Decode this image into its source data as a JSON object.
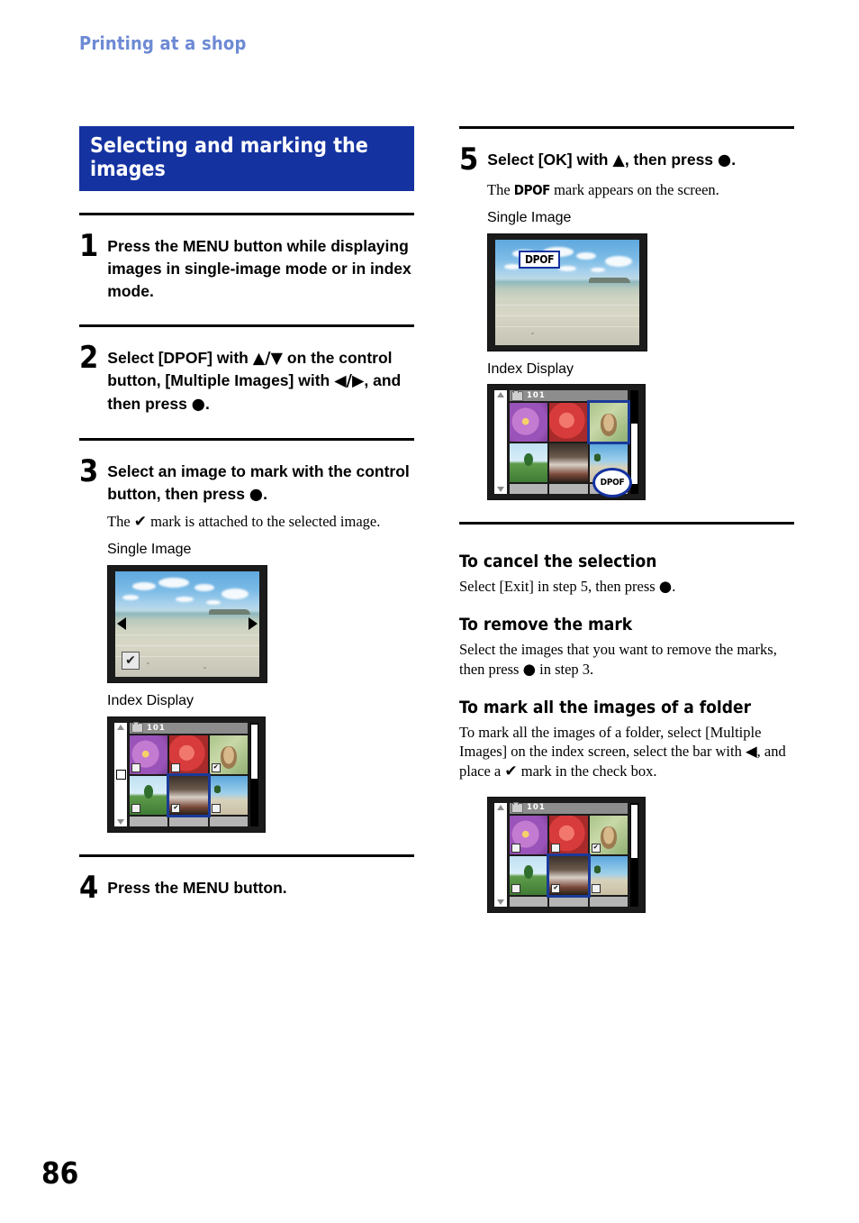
{
  "running_head": "Printing at a shop",
  "page_number": "86",
  "section": {
    "title_line1": "Selecting and marking the",
    "title_line2": "images"
  },
  "glyphs": {
    "up": "▲",
    "down": "▼",
    "left": "◀",
    "right": "▶",
    "enter": "●",
    "check": "✔",
    "checkbox_empty": "",
    "dpof": "DPOF"
  },
  "steps": [
    {
      "num": "1",
      "text": "Press the MENU button while displaying images in single-image mode or in index mode."
    },
    {
      "num": "2",
      "text_a": "Select [DPOF] with ",
      "arrow_ud": "▲/▼",
      "text_b": " on the control button, [Multiple Images] with ",
      "arrow_lr": "◀/▶",
      "text_c": ", and then press ",
      "enter": "●",
      "text_d": "."
    },
    {
      "num": "3",
      "text_a": "Select an image to mark with the control button, then press ",
      "enter": "●",
      "text_b": "."
    },
    {
      "num": "4",
      "text": "Press the MENU button."
    },
    {
      "num": "5",
      "text_a": "Select [OK] with ",
      "arrow_up": "▲",
      "text_b": ", then press ",
      "enter": "●",
      "text_c": "."
    }
  ],
  "step3_note": {
    "before": "The ",
    "mark": "✔",
    "after": " mark is attached to the selected image."
  },
  "step5_note": {
    "before": "The ",
    "mark": "DPOF",
    "after": " mark appears on the screen."
  },
  "captions": {
    "single_image": "Single Image",
    "index_display": "Index Display"
  },
  "screens": {
    "index_folder_label": "101",
    "dpof_badge": "DPOF",
    "dpof_callout": "DPOF",
    "check_mark": "✔"
  },
  "sections": [
    {
      "heading": "To cancel the selection",
      "body_a": "Select [Exit] in step 5, then press ",
      "enter": "●",
      "body_b": "."
    },
    {
      "heading": "To remove the mark",
      "body_a": "Select the images that you want to remove the marks, then press ",
      "enter": "●",
      "body_b": " in step 3."
    },
    {
      "heading": "To mark all the images of a folder",
      "body_a": "To mark all the images of a folder, select [Multiple Images] on the index screen, select the bar with ",
      "arrow_left": "◀",
      "body_b": ", and place a ",
      "mark": "✔",
      "body_c": " mark in the check box."
    }
  ]
}
